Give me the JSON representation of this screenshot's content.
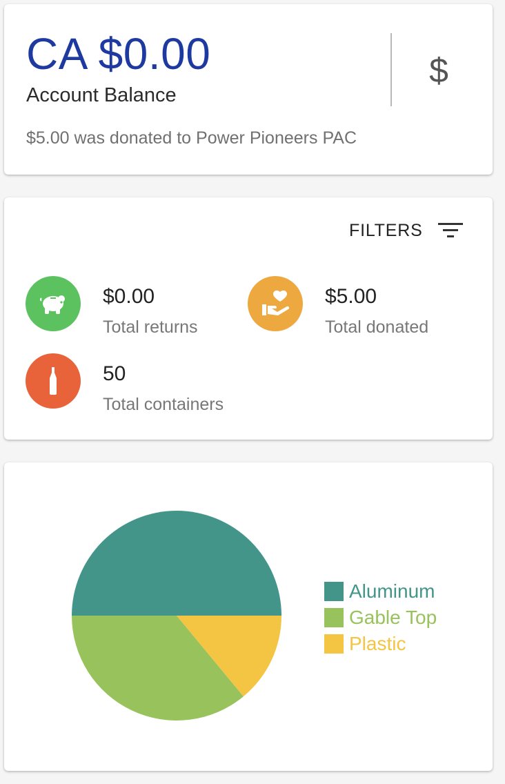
{
  "balance": {
    "amount": "CA $0.00",
    "label": "Account Balance",
    "note": "$5.00 was donated to Power Pioneers PAC",
    "amount_color": "#1e3aa0",
    "icon_text": "$"
  },
  "filters": {
    "label": "FILTERS",
    "icon": "filter-list-icon"
  },
  "stats": {
    "returns": {
      "value": "$0.00",
      "label": "Total returns",
      "icon": "piggy-bank-icon",
      "color": "#5bc25f"
    },
    "donated": {
      "value": "$5.00",
      "label": "Total donated",
      "icon": "donate-heart-hand-icon",
      "color": "#eda940"
    },
    "containers": {
      "value": "50",
      "label": "Total containers",
      "icon": "bottle-icon",
      "color": "#e8623a"
    }
  },
  "chart_data": {
    "type": "pie",
    "series": [
      {
        "name": "Aluminum",
        "value": 50,
        "color": "#43958a"
      },
      {
        "name": "Gable Top",
        "value": 36,
        "color": "#98c25b"
      },
      {
        "name": "Plastic",
        "value": 14,
        "color": "#f4c542"
      }
    ],
    "legend_position": "right"
  }
}
